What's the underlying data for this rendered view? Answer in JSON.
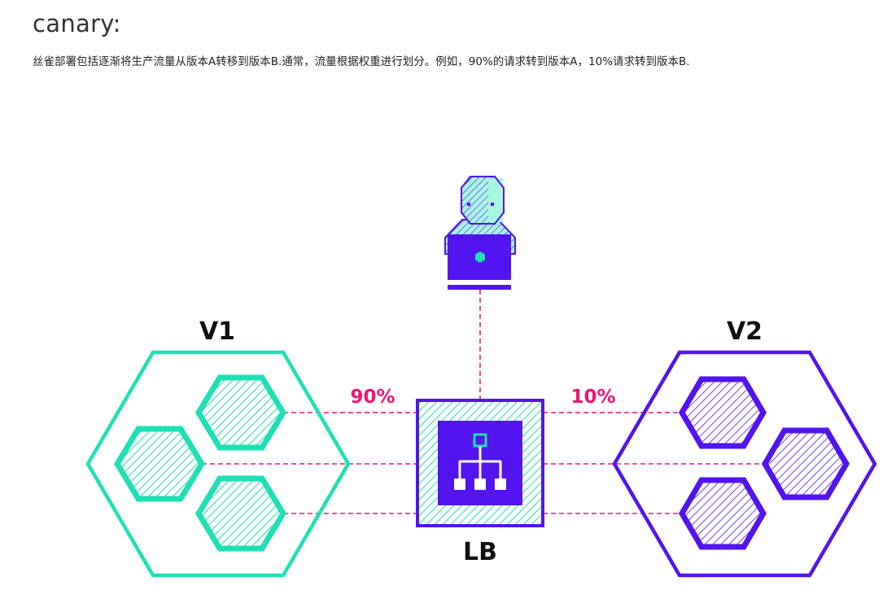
{
  "header": {
    "title": "canary:",
    "description": "丝雀部署包括逐渐将生产流量从版本A转移到版本B.通常，流量根据权重进行划分。例如，90%的请求转到版本A，10%请求转到版本B."
  },
  "diagram": {
    "v1_label": "V1",
    "v2_label": "V2",
    "lb_label": "LB",
    "v1_percent": "90%",
    "v2_percent": "10%"
  },
  "colors": {
    "teal": "#1ee0b4",
    "purple": "#5314f0",
    "pink": "#f01478",
    "light_teal": "#a8f5e2"
  },
  "icons": [
    "user-icon",
    "laptop-icon",
    "load-balancer-icon",
    "hierarchy-icon"
  ]
}
